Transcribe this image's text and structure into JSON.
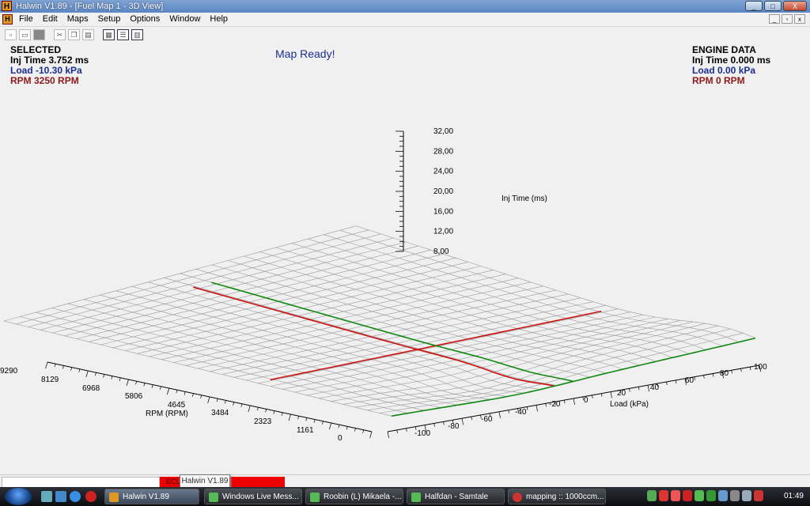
{
  "window": {
    "app_icon_letter": "H",
    "title": "Halwin V1.89 - [Fuel Map 1 - 3D View]",
    "minimize": "_",
    "maximize": "□",
    "close": "X"
  },
  "menu": {
    "icon_letter": "H",
    "items": [
      "File",
      "Edit",
      "Maps",
      "Setup",
      "Options",
      "Window",
      "Help"
    ],
    "mdi_minimize": "_",
    "mdi_restore": "▫",
    "mdi_close": "x"
  },
  "toolbar": {
    "icons": [
      "new-icon",
      "open-icon",
      "save-icon",
      "cut-icon",
      "copy-icon",
      "paste-icon",
      "cascade-icon",
      "tile-horizontal-icon",
      "tile-vertical-icon"
    ]
  },
  "selected": {
    "heading": "SELECTED",
    "inj_time": "Inj Time 3.752 ms",
    "load": "Load -10.30 kPa",
    "rpm": "RPM 3250 RPM"
  },
  "status": {
    "message": "Map Ready!"
  },
  "engine": {
    "heading": "ENGINE DATA",
    "inj_time": "Inj Time 0.000 ms",
    "load": "Load 0.00 kPa",
    "rpm": "RPM 0 RPM"
  },
  "chart_data": {
    "type": "surface-3d",
    "z_label": "Inj Time (ms)",
    "z_ticks": [
      "32,00",
      "28,00",
      "24,00",
      "20,00",
      "16,00",
      "12,00",
      "8,00"
    ],
    "rpm_label": "RPM (RPM)",
    "rpm_ticks": [
      "9290",
      "8129",
      "6968",
      "5806",
      "4645",
      "3484",
      "2323",
      "1161",
      "0"
    ],
    "load_label": "Load (kPa)",
    "load_ticks": [
      "-100",
      "-80",
      "-60",
      "-40",
      "-20",
      "0",
      "20",
      "40",
      "60",
      "80",
      "100"
    ],
    "selected_rpm": 3250,
    "selected_load": -10.3,
    "selected_inj_time": 3.752,
    "colors": {
      "surface": "#9a9a9a",
      "selected_line": "#cc1111",
      "engine_line": "#118811"
    }
  },
  "statusbar": {
    "red_text": "ECU",
    "tooltip": "Halwin V1.89"
  },
  "taskbar": {
    "tasks": [
      {
        "label": "Halwin V1.89",
        "active": true
      },
      {
        "label": "Windows Live Mess...",
        "active": false
      },
      {
        "label": "Roobin (L) Mikaela -...",
        "active": false
      },
      {
        "label": "Halfdan - Samtale",
        "active": false
      },
      {
        "label": "mapping :: 1000ccm...",
        "active": false
      }
    ],
    "clock": "01:49"
  }
}
